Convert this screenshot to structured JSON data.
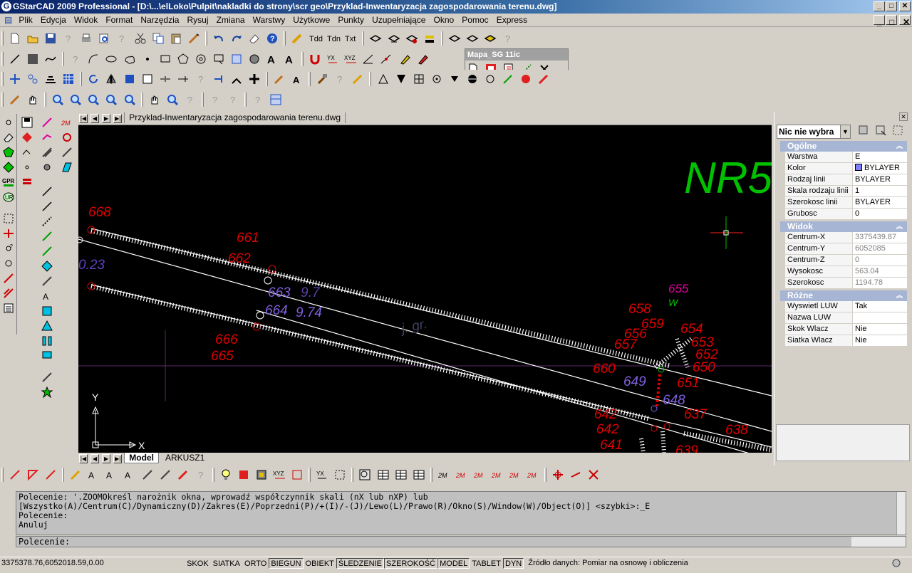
{
  "window": {
    "title": "GStarCAD 2009 Professional - [D:\\...\\elLoko\\Pulpit\\nakladki do strony\\scr geo\\Przyklad-Inwentaryzacja zagospodarowania terenu.dwg]",
    "logo_letter": "G",
    "min": "_",
    "max": "□",
    "close": "✕"
  },
  "menu": [
    "Plik",
    "Edycja",
    "Widok",
    "Format",
    "Narzędzia",
    "Rysuj",
    "Zmiana",
    "Warstwy",
    "Użytkowe",
    "Punkty",
    "Uzupełniające",
    "Okno",
    "Pomoc",
    "Express"
  ],
  "toolbar_text_icons": {
    "tdd1": "Tdd",
    "tdn": "Tdn",
    "txt": "Txt",
    "xyz": "XYZ",
    "yx": "YX",
    "aa": "A"
  },
  "floating_toolbar": {
    "title": "Mapa_SG 11ic",
    "close": "✕"
  },
  "left_palette": {
    "gpr": "GPR",
    "ur": "UR",
    "2m_a": "2M",
    "2m_b": "2M"
  },
  "document_tab": "Przyklad-Inwentaryzacja zagospodarowania terenu.dwg",
  "layout_tabs": [
    "Model",
    "ARKUSZ1"
  ],
  "drawing_labels": {
    "nr5": "NR5,",
    "l668": "668",
    "l661": "661",
    "l662": "662",
    "l023": "0.23",
    "l663": "663",
    "l974a": "9.7",
    "l664": "664",
    "l974b": "9.74",
    "l666": "666",
    "l665": "665",
    "ljgr": "j. gr.",
    "l655": "655",
    "lw": "W",
    "l658": "658",
    "l659": "659",
    "l656": "656",
    "l657": "657",
    "l654": "654",
    "l653": "653",
    "l652": "652",
    "l650": "650",
    "l660": "660",
    "l649": "649",
    "l651": "651",
    "l648": "648",
    "l637": "637",
    "l642": "642",
    "l641": "641",
    "l639": "639",
    "l638": "638",
    "axis_y": "Y",
    "axis_x": "X"
  },
  "properties": {
    "selector": "Nic nie wybra",
    "sections": [
      {
        "name": "Ogólne",
        "rows": [
          {
            "k": "Warstwa",
            "v": "E"
          },
          {
            "k": "Kolor",
            "v": "BYLAYER"
          },
          {
            "k": "Rodzaj linii",
            "v": "BYLAYER"
          },
          {
            "k": "Skala rodzaju linii",
            "v": "1"
          },
          {
            "k": "Szerokosc linii",
            "v": "BYLAYER"
          },
          {
            "k": "Grubosc",
            "v": "0"
          }
        ]
      },
      {
        "name": "Widok",
        "rows": [
          {
            "k": "Centrum-X",
            "v": "3375439.87"
          },
          {
            "k": "Centrum-Y",
            "v": "6052085"
          },
          {
            "k": "Centrum-Z",
            "v": "0"
          },
          {
            "k": "Wysokosc",
            "v": "563.04"
          },
          {
            "k": "Szerokosc",
            "v": "1194.78"
          }
        ]
      },
      {
        "name": "Różne",
        "rows": [
          {
            "k": "Wyswietl LUW",
            "v": "Tak"
          },
          {
            "k": "Nazwa LUW",
            "v": ""
          },
          {
            "k": "Skok Wlacz",
            "v": "Nie"
          },
          {
            "k": "Siatka Wlacz",
            "v": "Nie"
          }
        ]
      }
    ]
  },
  "command_history": [
    "Polecenie: '.ZOOMOkreśl narożnik okna, wprowadź współczynnik skali (nX lub nXP) lub",
    "[Wszystko(A)/Centrum(C)/Dynamiczny(D)/Zakres(E)/Poprzedni(P)/+(I)/-(J)/Lewo(L)/Prawo(R)/Okno(S)/Window(W)/Object(O)] <szybki>:_E",
    "Polecenie:",
    "Anuluj"
  ],
  "command_prompt": "Polecenie:",
  "status": {
    "coords": "3375378.76,6052018.59,0.00",
    "buttons": [
      {
        "label": "SKOK",
        "on": false
      },
      {
        "label": "SIATKA",
        "on": false
      },
      {
        "label": "ORTO",
        "on": false
      },
      {
        "label": "BIEGUN",
        "on": true
      },
      {
        "label": "OBIEKT",
        "on": false
      },
      {
        "label": "ŚLEDZENIE",
        "on": true
      },
      {
        "label": "SZEROKOŚĆ",
        "on": true
      },
      {
        "label": "MODEL",
        "on": true
      },
      {
        "label": "TABLET",
        "on": false
      },
      {
        "label": "DYN",
        "on": true
      }
    ],
    "source": "Źródło danych: Pomiar na osnowę i obliczenia"
  },
  "colors": {
    "label_red": "#e00000",
    "label_purple": "#8060e0",
    "label_magenta": "#e000a0",
    "nr_green": "#00c000",
    "crosshair": "#ff2020"
  }
}
